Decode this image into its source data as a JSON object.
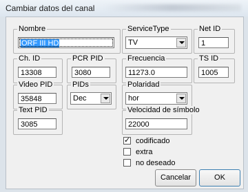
{
  "window": {
    "title": "Cambiar datos del canal"
  },
  "fields": {
    "nombre": {
      "label": "Nombre",
      "value": "ORF III HD"
    },
    "service_type": {
      "label": "ServiceType",
      "value": "TV"
    },
    "net_id": {
      "label": "Net ID",
      "value": "1"
    },
    "ch_id": {
      "label": "Ch. ID",
      "value": "13308"
    },
    "pcr_pid": {
      "label": "PCR PID",
      "value": "3080"
    },
    "frecuencia": {
      "label": "Frecuencia",
      "value": "11273.0"
    },
    "ts_id": {
      "label": "TS ID",
      "value": "1005"
    },
    "video_pid": {
      "label": "Video PID",
      "value": "35848"
    },
    "pids": {
      "label": "PIDs",
      "value": "Dec"
    },
    "polaridad": {
      "label": "Polaridad",
      "value": "hor"
    },
    "text_pid": {
      "label": "Text PID",
      "value": "3085"
    },
    "velocidad": {
      "label": "Velocidad de símbolo",
      "value": "22000"
    }
  },
  "checkboxes": [
    {
      "label": "codificado",
      "checked": true,
      "mark": "✓"
    },
    {
      "label": "extra",
      "checked": false,
      "mark": ""
    },
    {
      "label": "no deseado",
      "checked": false,
      "mark": ""
    }
  ],
  "buttons": {
    "cancel": "Cancelar",
    "ok": "OK"
  }
}
